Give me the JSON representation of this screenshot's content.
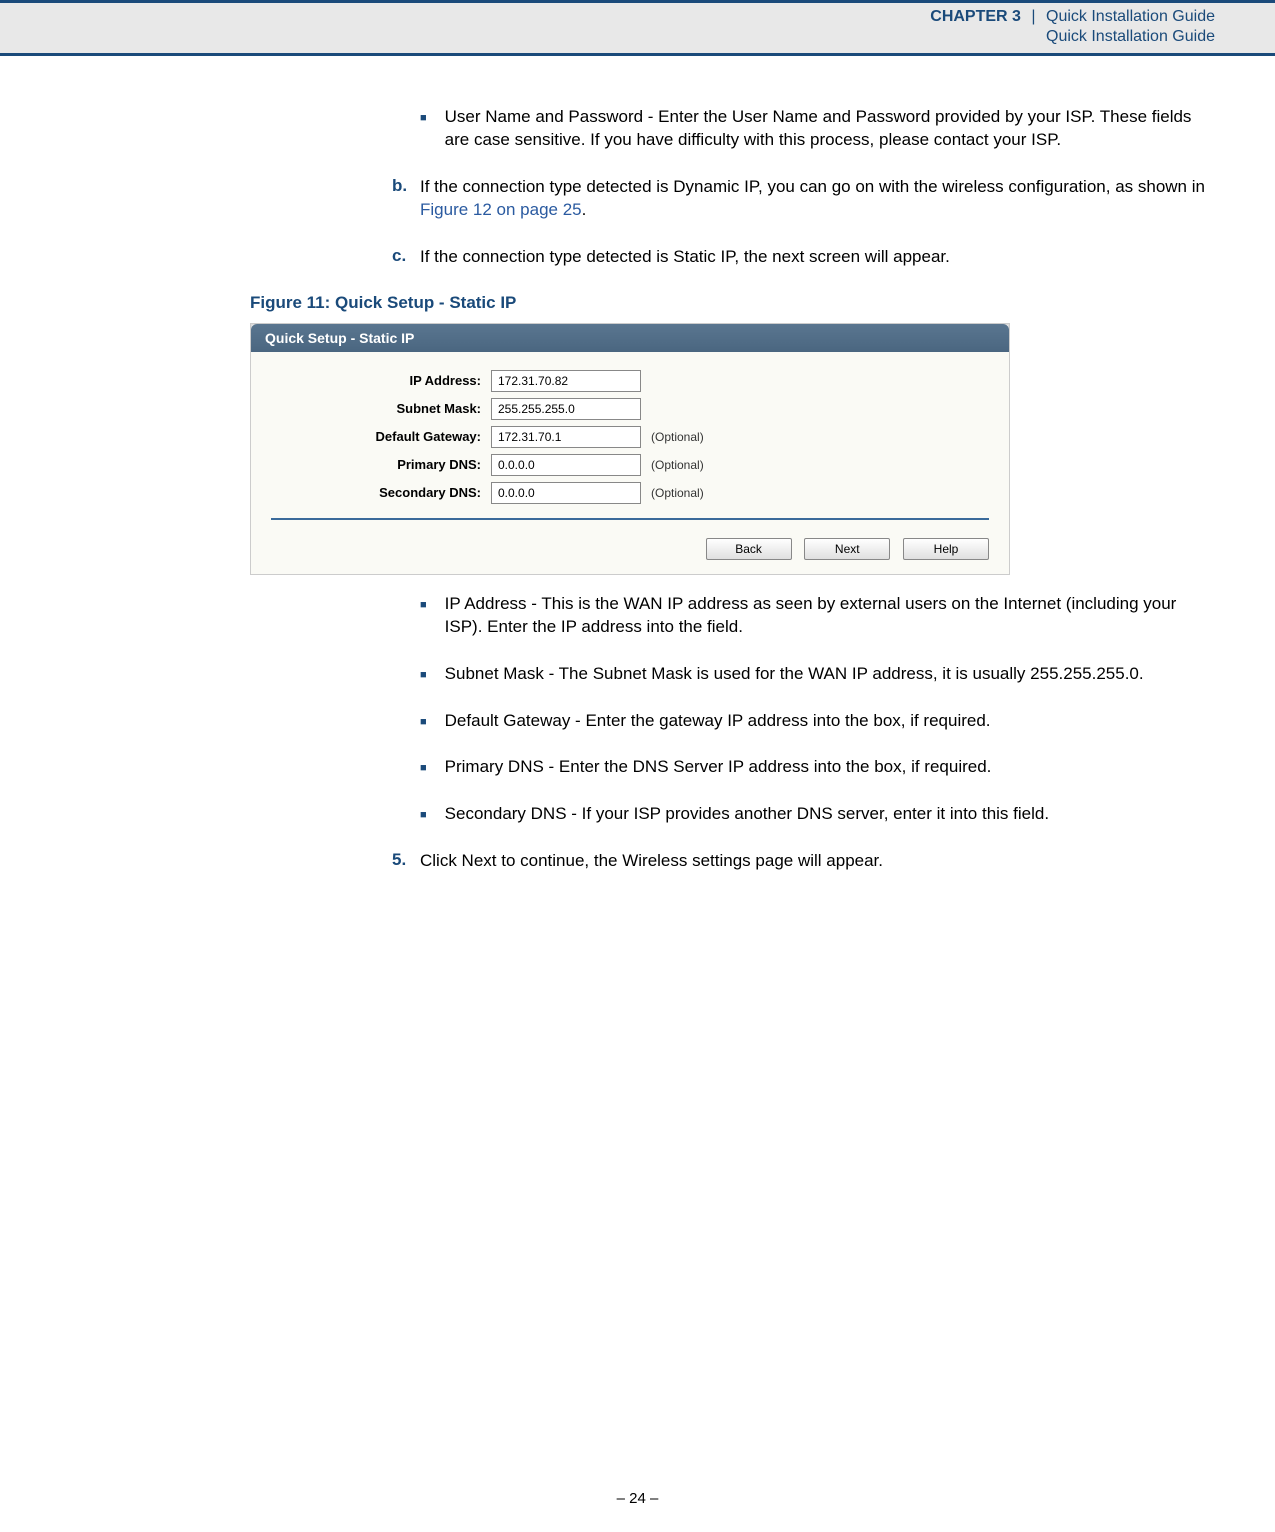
{
  "header": {
    "chapter_label": "CHAPTER 3",
    "separator": "|",
    "title1": "Quick Installation Guide",
    "title2": "Quick Installation Guide"
  },
  "intro_bullet": "User Name and Password - Enter the User Name and Password provided by your ISP. These fields are case sensitive. If you have difficulty with this process, please contact your ISP.",
  "item_b": {
    "letter": "b.",
    "text_pre": "If the connection type detected is Dynamic IP, you can go on with the wireless configuration, as shown in ",
    "link": "Figure 12 on page 25",
    "text_post": "."
  },
  "item_c": {
    "letter": "c.",
    "text": "If the connection type detected is Static IP, the next screen will appear."
  },
  "figure": {
    "caption": "Figure 11:  Quick Setup - Static IP",
    "title": "Quick Setup - Static IP",
    "fields": {
      "ip_label": "IP Address:",
      "ip_value": "172.31.70.82",
      "subnet_label": "Subnet Mask:",
      "subnet_value": "255.255.255.0",
      "gateway_label": "Default Gateway:",
      "gateway_value": "172.31.70.1",
      "gateway_optional": "(Optional)",
      "pdns_label": "Primary DNS:",
      "pdns_value": "0.0.0.0",
      "pdns_optional": "(Optional)",
      "sdns_label": "Secondary DNS:",
      "sdns_value": "0.0.0.0",
      "sdns_optional": "(Optional)"
    },
    "buttons": {
      "back": "Back",
      "next": "Next",
      "help": "Help"
    }
  },
  "desc_bullets": [
    "IP Address - This is the WAN IP address as seen by external users on the Internet (including your ISP). Enter the IP address into the field.",
    "Subnet Mask - The Subnet Mask is used for the WAN IP address, it is usually 255.255.255.0.",
    "Default Gateway - Enter the gateway IP address into the box, if required.",
    "Primary DNS - Enter the DNS Server IP address into the box, if required.",
    "Secondary DNS - If your ISP provides another DNS server, enter it into this field."
  ],
  "step5": {
    "num": "5.",
    "text": "Click Next to continue, the Wireless settings page will appear."
  },
  "footer": "–  24  –"
}
